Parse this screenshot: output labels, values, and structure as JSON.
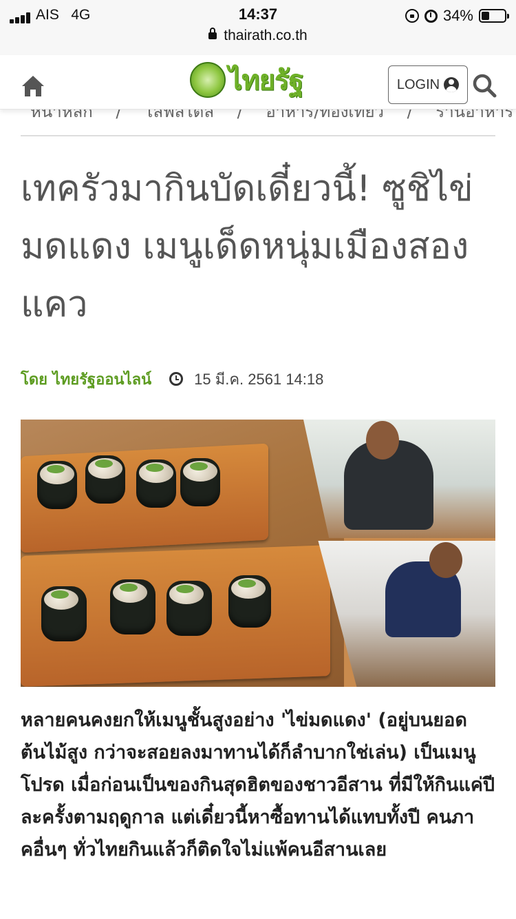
{
  "status_bar": {
    "carrier": "AIS",
    "network": "4G",
    "time": "14:37",
    "battery_pct": "34%",
    "battery_level": 0.34,
    "url": "thairath.co.th"
  },
  "header": {
    "logo_text": "ไทยรัฐ",
    "login_label": "LOGIN"
  },
  "breadcrumb": [
    "หน้าหลัก",
    "/",
    "ไลฟ์สไตล์",
    "/",
    "อาหาร/ท่องเที่ยว",
    "/",
    "ร้านอาหาร"
  ],
  "article": {
    "title": "เทครัวมากินบัดเดี๋ยวนี้! ซูชิไข่มดแดง เมนูเด็ดหนุ่มเมืองสองแคว",
    "author": "โดย ไทยรัฐออนไลน์",
    "date": "15 มี.ค. 2561 14:18",
    "body": "หลายคนคงยกให้เมนูชั้นสูงอย่าง 'ไข่มดแดง' (อยู่บนยอดต้นไม้สูง กว่าจะสอยลงมาทานได้ก็ลำบากใช่เล่น) เป็นเมนูโปรด เมื่อก่อนเป็นของกินสุดฮิตของชาวอีสาน ที่มีให้กินแค่ปีละครั้งตามฤดูกาล แต่เดี๋ยวนี้หาซื้อทานได้แทบทั้งปี คนภาคอื่นๆ ทั่วไทยกินแล้วก็ติดใจไม่แพ้คนอีสานเลย"
  },
  "colors": {
    "author_green": "#5d9c21",
    "logo_green": "#6fb128"
  }
}
